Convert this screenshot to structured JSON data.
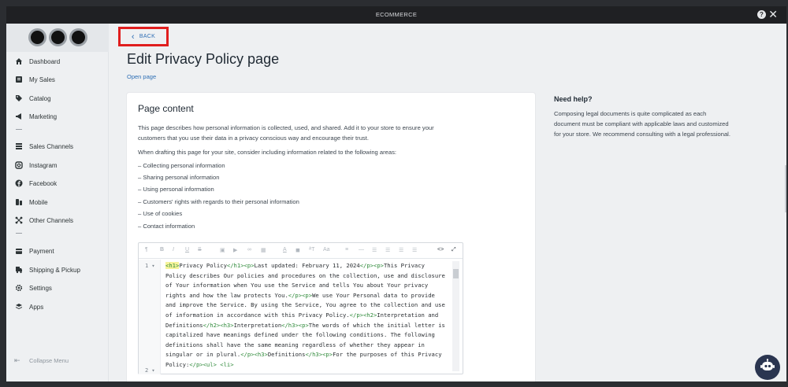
{
  "window": {
    "title": "ECOMMERCE"
  },
  "sidebar": {
    "items": [
      {
        "label": "Dashboard",
        "icon": "home-icon"
      },
      {
        "label": "My Sales",
        "icon": "sales-icon"
      },
      {
        "label": "Catalog",
        "icon": "tag-icon"
      },
      {
        "label": "Marketing",
        "icon": "megaphone-icon"
      },
      {
        "label": "Sales Channels",
        "icon": "channels-icon"
      },
      {
        "label": "Instagram",
        "icon": "instagram-icon"
      },
      {
        "label": "Facebook",
        "icon": "facebook-icon"
      },
      {
        "label": "Mobile",
        "icon": "mobile-icon"
      },
      {
        "label": "Other Channels",
        "icon": "network-icon"
      },
      {
        "label": "Payment",
        "icon": "payment-icon"
      },
      {
        "label": "Shipping & Pickup",
        "icon": "truck-icon"
      },
      {
        "label": "Settings",
        "icon": "gear-icon"
      },
      {
        "label": "Apps",
        "icon": "layers-icon"
      }
    ],
    "collapse_label": "Collapse Menu"
  },
  "main": {
    "back_label": "BACK",
    "page_title": "Edit Privacy Policy page",
    "open_page_label": "Open page",
    "card": {
      "title": "Page content",
      "intro": "This page describes how personal information is collected, used, and shared. Add it to your store to ensure your customers that you use their data in a privacy conscious way and encourage their trust.",
      "drafting_note": "When drafting this page for your site, consider including information related to the following areas:",
      "bullets": [
        "– Collecting personal information",
        "– Sharing personal information",
        "– Using personal information",
        "– Customers' rights with regards to their personal information",
        "– Use of cookies",
        "– Contact information"
      ],
      "editor": {
        "line_numbers": [
          "1 ▾",
          "2 ▾"
        ],
        "code": {
          "t1": "<h1>",
          "s1": "Privacy Policy",
          "t2": "</h1><p>",
          "s2": "Last updated: February 11, 2024",
          "t3": "</p><p>",
          "s3": "This Privacy Policy describes Our policies and procedures on the collection, use and disclosure of Your information when You use the Service and tells You about Your privacy rights and how the law protects You.",
          "t4": "</p><p>",
          "s4": "We use Your Personal data to provide and improve the Service. By using the Service, You agree to the collection and use of information in accordance with this Privacy Policy.",
          "t5": "</p><h2>",
          "s5": "Interpretation and Definitions",
          "t6": "</h2><h3>",
          "s6": "Interpretation",
          "t7": "</h3><p>",
          "s7": "The words of which the initial letter is capitalized have meanings defined under the following conditions. The following definitions shall have the same meaning regardless of whether they appear in singular or in plural.",
          "t8": "</p><h3>",
          "s8": "Definitions",
          "t9": "</h3><p>",
          "s9": "For the purposes of this Privacy Policy:",
          "t10": "</p><ul>",
          "t11": "<li>"
        }
      }
    }
  },
  "help": {
    "title": "Need help?",
    "text": "Composing legal documents is quite complicated as each document must be compliant with applicable laws and customized for your store. We recommend consulting with a legal professional."
  },
  "colors": {
    "accent": "#2f6fb5",
    "highlight_border": "#e01e1e",
    "code_tag": "#2f8a3a"
  }
}
